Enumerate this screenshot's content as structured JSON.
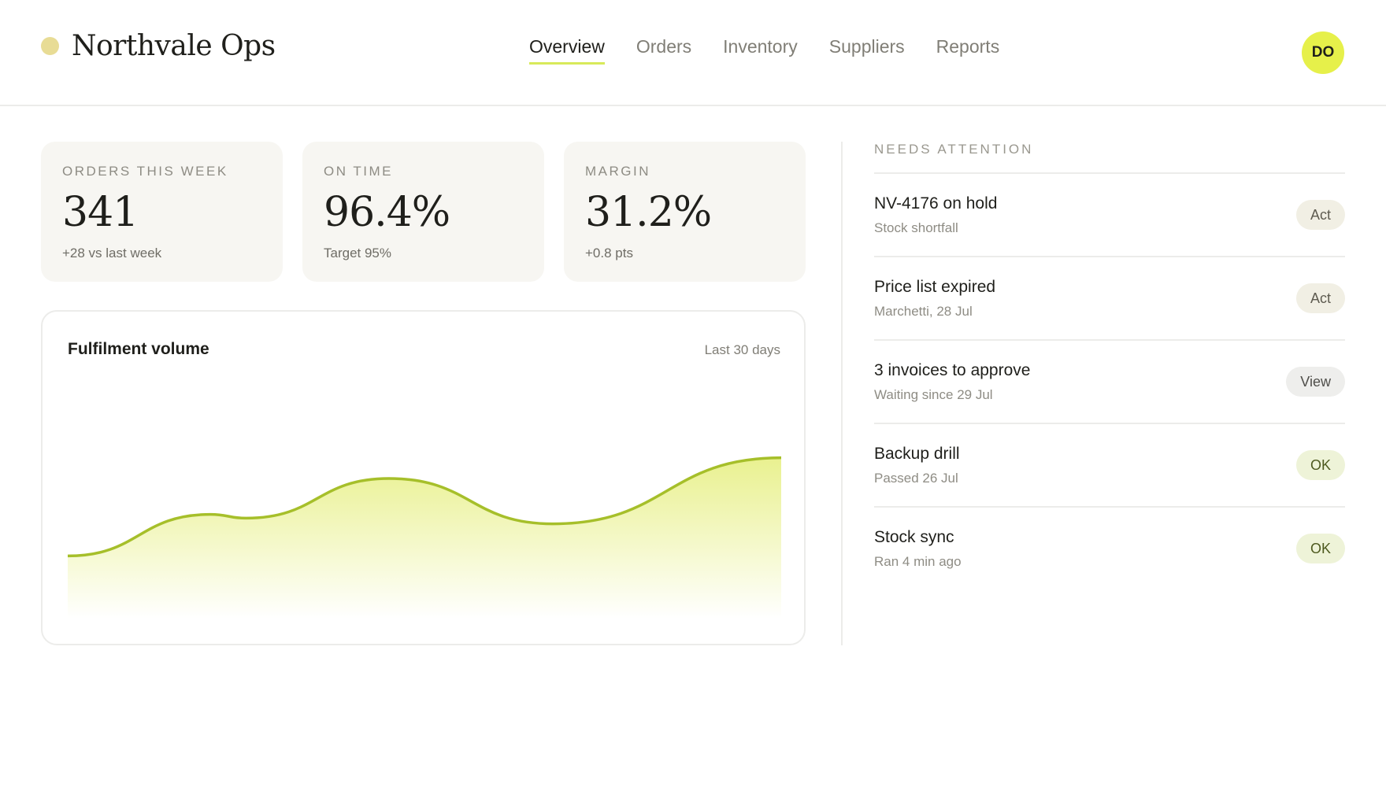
{
  "app": {
    "brand_name": "Northvale Ops",
    "brand_dot_color": "#e8dc95",
    "accent_color": "#d8ea5a"
  },
  "nav": {
    "tabs": [
      {
        "label": "Overview",
        "active": true
      },
      {
        "label": "Orders",
        "active": false
      },
      {
        "label": "Inventory",
        "active": false
      },
      {
        "label": "Suppliers",
        "active": false
      },
      {
        "label": "Reports",
        "active": false
      }
    ]
  },
  "user": {
    "initials": "DO",
    "avatar_color": "#e6f04a"
  },
  "kpis": [
    {
      "label": "ORDERS THIS WEEK",
      "value": "341",
      "note": "+28 vs last week"
    },
    {
      "label": "ON TIME",
      "value": "96.4%",
      "note": "Target 95%"
    },
    {
      "label": "MARGIN",
      "value": "31.2%",
      "note": "+0.8 pts"
    }
  ],
  "chart": {
    "title": "Fulfilment volume",
    "range_label": "Last 30 days",
    "line_color": "#a6bf2a",
    "fill_color": "#e8f08a"
  },
  "chart_data": {
    "type": "area",
    "title": "Fulfilment volume",
    "subtitle": "Last 30 days",
    "xlabel": "",
    "ylabel": "",
    "grid": false,
    "legend": "none",
    "x": [
      0,
      0.2,
      0.25,
      0.45,
      0.68,
      1.0
    ],
    "values": [
      0.24,
      0.46,
      0.44,
      0.65,
      0.41,
      0.76
    ]
  },
  "attention": {
    "heading": "NEEDS ATTENTION",
    "items": [
      {
        "title": "NV-4176 on hold",
        "subtitle": "Stock shortfall",
        "action": "Act",
        "kind": "act"
      },
      {
        "title": "Price list expired",
        "subtitle": "Marchetti, 28 Jul",
        "action": "Act",
        "kind": "act"
      },
      {
        "title": "3 invoices to approve",
        "subtitle": "Waiting since 29 Jul",
        "action": "View",
        "kind": "view"
      },
      {
        "title": "Backup drill",
        "subtitle": "Passed 26 Jul",
        "action": "OK",
        "kind": "ok"
      },
      {
        "title": "Stock sync",
        "subtitle": "Ran 4 min ago",
        "action": "OK",
        "kind": "ok"
      }
    ]
  }
}
